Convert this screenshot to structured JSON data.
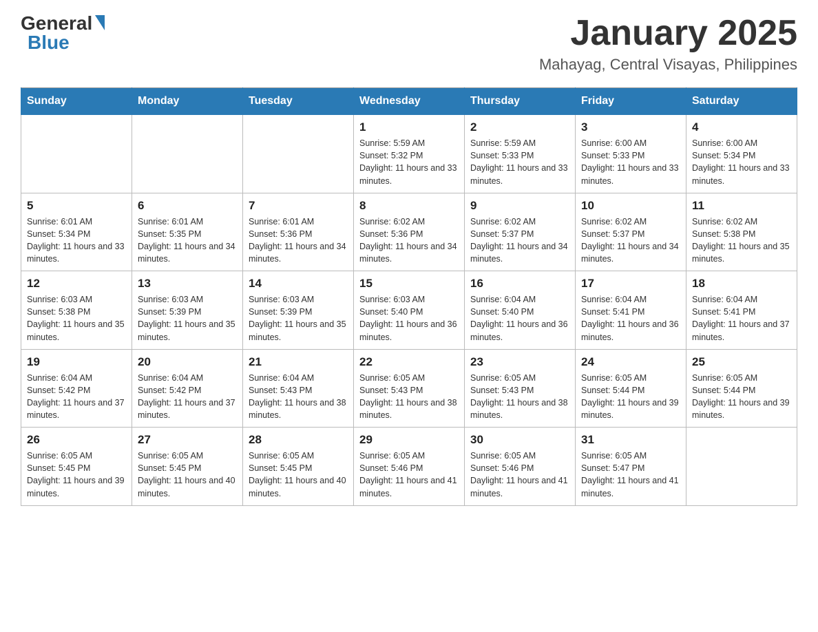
{
  "logo": {
    "general": "General",
    "blue": "Blue",
    "triangle": "▼"
  },
  "title": "January 2025",
  "location": "Mahayag, Central Visayas, Philippines",
  "days_of_week": [
    "Sunday",
    "Monday",
    "Tuesday",
    "Wednesday",
    "Thursday",
    "Friday",
    "Saturday"
  ],
  "weeks": [
    [
      {
        "day": "",
        "info": ""
      },
      {
        "day": "",
        "info": ""
      },
      {
        "day": "",
        "info": ""
      },
      {
        "day": "1",
        "info": "Sunrise: 5:59 AM\nSunset: 5:32 PM\nDaylight: 11 hours and 33 minutes."
      },
      {
        "day": "2",
        "info": "Sunrise: 5:59 AM\nSunset: 5:33 PM\nDaylight: 11 hours and 33 minutes."
      },
      {
        "day": "3",
        "info": "Sunrise: 6:00 AM\nSunset: 5:33 PM\nDaylight: 11 hours and 33 minutes."
      },
      {
        "day": "4",
        "info": "Sunrise: 6:00 AM\nSunset: 5:34 PM\nDaylight: 11 hours and 33 minutes."
      }
    ],
    [
      {
        "day": "5",
        "info": "Sunrise: 6:01 AM\nSunset: 5:34 PM\nDaylight: 11 hours and 33 minutes."
      },
      {
        "day": "6",
        "info": "Sunrise: 6:01 AM\nSunset: 5:35 PM\nDaylight: 11 hours and 34 minutes."
      },
      {
        "day": "7",
        "info": "Sunrise: 6:01 AM\nSunset: 5:36 PM\nDaylight: 11 hours and 34 minutes."
      },
      {
        "day": "8",
        "info": "Sunrise: 6:02 AM\nSunset: 5:36 PM\nDaylight: 11 hours and 34 minutes."
      },
      {
        "day": "9",
        "info": "Sunrise: 6:02 AM\nSunset: 5:37 PM\nDaylight: 11 hours and 34 minutes."
      },
      {
        "day": "10",
        "info": "Sunrise: 6:02 AM\nSunset: 5:37 PM\nDaylight: 11 hours and 34 minutes."
      },
      {
        "day": "11",
        "info": "Sunrise: 6:02 AM\nSunset: 5:38 PM\nDaylight: 11 hours and 35 minutes."
      }
    ],
    [
      {
        "day": "12",
        "info": "Sunrise: 6:03 AM\nSunset: 5:38 PM\nDaylight: 11 hours and 35 minutes."
      },
      {
        "day": "13",
        "info": "Sunrise: 6:03 AM\nSunset: 5:39 PM\nDaylight: 11 hours and 35 minutes."
      },
      {
        "day": "14",
        "info": "Sunrise: 6:03 AM\nSunset: 5:39 PM\nDaylight: 11 hours and 35 minutes."
      },
      {
        "day": "15",
        "info": "Sunrise: 6:03 AM\nSunset: 5:40 PM\nDaylight: 11 hours and 36 minutes."
      },
      {
        "day": "16",
        "info": "Sunrise: 6:04 AM\nSunset: 5:40 PM\nDaylight: 11 hours and 36 minutes."
      },
      {
        "day": "17",
        "info": "Sunrise: 6:04 AM\nSunset: 5:41 PM\nDaylight: 11 hours and 36 minutes."
      },
      {
        "day": "18",
        "info": "Sunrise: 6:04 AM\nSunset: 5:41 PM\nDaylight: 11 hours and 37 minutes."
      }
    ],
    [
      {
        "day": "19",
        "info": "Sunrise: 6:04 AM\nSunset: 5:42 PM\nDaylight: 11 hours and 37 minutes."
      },
      {
        "day": "20",
        "info": "Sunrise: 6:04 AM\nSunset: 5:42 PM\nDaylight: 11 hours and 37 minutes."
      },
      {
        "day": "21",
        "info": "Sunrise: 6:04 AM\nSunset: 5:43 PM\nDaylight: 11 hours and 38 minutes."
      },
      {
        "day": "22",
        "info": "Sunrise: 6:05 AM\nSunset: 5:43 PM\nDaylight: 11 hours and 38 minutes."
      },
      {
        "day": "23",
        "info": "Sunrise: 6:05 AM\nSunset: 5:43 PM\nDaylight: 11 hours and 38 minutes."
      },
      {
        "day": "24",
        "info": "Sunrise: 6:05 AM\nSunset: 5:44 PM\nDaylight: 11 hours and 39 minutes."
      },
      {
        "day": "25",
        "info": "Sunrise: 6:05 AM\nSunset: 5:44 PM\nDaylight: 11 hours and 39 minutes."
      }
    ],
    [
      {
        "day": "26",
        "info": "Sunrise: 6:05 AM\nSunset: 5:45 PM\nDaylight: 11 hours and 39 minutes."
      },
      {
        "day": "27",
        "info": "Sunrise: 6:05 AM\nSunset: 5:45 PM\nDaylight: 11 hours and 40 minutes."
      },
      {
        "day": "28",
        "info": "Sunrise: 6:05 AM\nSunset: 5:45 PM\nDaylight: 11 hours and 40 minutes."
      },
      {
        "day": "29",
        "info": "Sunrise: 6:05 AM\nSunset: 5:46 PM\nDaylight: 11 hours and 41 minutes."
      },
      {
        "day": "30",
        "info": "Sunrise: 6:05 AM\nSunset: 5:46 PM\nDaylight: 11 hours and 41 minutes."
      },
      {
        "day": "31",
        "info": "Sunrise: 6:05 AM\nSunset: 5:47 PM\nDaylight: 11 hours and 41 minutes."
      },
      {
        "day": "",
        "info": ""
      }
    ]
  ]
}
